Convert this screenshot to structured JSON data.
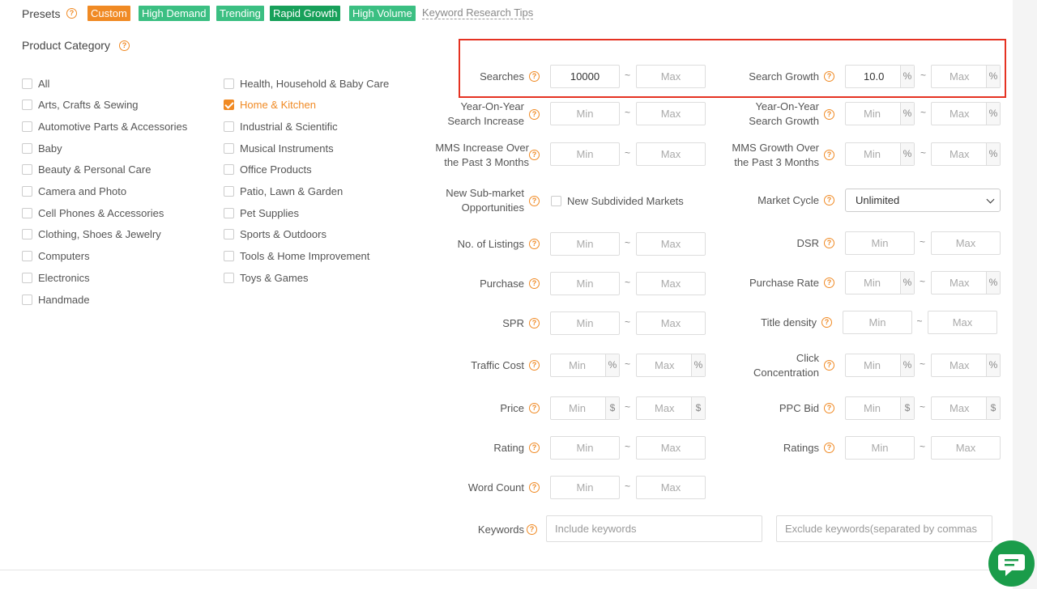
{
  "presets": {
    "label": "Presets",
    "tags": [
      {
        "label": "Custom",
        "color": "#f08a24"
      },
      {
        "label": "High Demand",
        "color": "#3bbf82"
      },
      {
        "label": "Trending",
        "color": "#3bbf82"
      },
      {
        "label": "Rapid Growth",
        "color": "#17a05a"
      },
      {
        "label": "High Volume",
        "color": "#3bbf82"
      }
    ],
    "tips": "Keyword Research Tips"
  },
  "categories": {
    "title": "Product Category",
    "col1": [
      "All",
      "Arts, Crafts & Sewing",
      "Automotive Parts & Accessories",
      "Baby",
      "Beauty & Personal Care",
      "Camera and Photo",
      "Cell Phones & Accessories",
      "Clothing, Shoes & Jewelry",
      "Computers",
      "Electronics",
      "Handmade"
    ],
    "col2": [
      "Health, Household & Baby Care",
      "Home & Kitchen",
      "Industrial & Scientific",
      "Musical Instruments",
      "Office Products",
      "Patio, Lawn & Garden",
      "Pet Supplies",
      "Sports & Outdoors",
      "Tools & Home Improvement",
      "Toys & Games"
    ],
    "selected": "Home & Kitchen"
  },
  "filters": {
    "searches": {
      "label": "Searches",
      "min": "10000",
      "max_ph": "Max"
    },
    "search_growth": {
      "label": "Search Growth",
      "min": "10.0",
      "max_ph": "Max"
    },
    "yoy_increase": {
      "label1": "Year-On-Year",
      "label2": "Search Increase",
      "min_ph": "Min",
      "max_ph": "Max"
    },
    "yoy_growth": {
      "label1": "Year-On-Year",
      "label2": "Search Growth",
      "min_ph": "Min",
      "max_ph": "Max"
    },
    "mms_increase": {
      "label1": "MMS Increase Over",
      "label2": "the Past 3 Months",
      "min_ph": "Min",
      "max_ph": "Max"
    },
    "mms_growth": {
      "label1": "MMS Growth Over",
      "label2": "the Past 3 Months",
      "min_ph": "Min",
      "max_ph": "Max"
    },
    "new_sub": {
      "label1": "New Sub-market",
      "label2": "Opportunities",
      "checkbox": "New Subdivided Markets"
    },
    "market_cycle": {
      "label": "Market Cycle",
      "value": "Unlimited"
    },
    "listings": {
      "label": "No. of Listings",
      "min_ph": "Min",
      "max_ph": "Max"
    },
    "dsr": {
      "label": "DSR",
      "min_ph": "Min",
      "max_ph": "Max"
    },
    "purchase": {
      "label": "Purchase",
      "min_ph": "Min",
      "max_ph": "Max"
    },
    "purchase_rate": {
      "label": "Purchase Rate",
      "min_ph": "Min",
      "max_ph": "Max"
    },
    "spr": {
      "label": "SPR",
      "min_ph": "Min",
      "max_ph": "Max"
    },
    "title_density": {
      "label": "Title density",
      "min_ph": "Min",
      "max_ph": "Max"
    },
    "traffic_cost": {
      "label": "Traffic Cost",
      "min_ph": "Min",
      "max_ph": "Max"
    },
    "click_conc": {
      "label1": "Click",
      "label2": "Concentration",
      "min_ph": "Min",
      "max_ph": "Max"
    },
    "price": {
      "label": "Price",
      "min_ph": "Min",
      "max_ph": "Max"
    },
    "ppc_bid": {
      "label": "PPC Bid",
      "min_ph": "Min",
      "max_ph": "Max"
    },
    "rating": {
      "label": "Rating",
      "min_ph": "Min",
      "max_ph": "Max"
    },
    "ratings": {
      "label": "Ratings",
      "min_ph": "Min",
      "max_ph": "Max"
    },
    "word_count": {
      "label": "Word Count",
      "min_ph": "Min",
      "max_ph": "Max"
    },
    "keywords": {
      "label": "Keywords",
      "include_ph": "Include keywords",
      "exclude_ph": "Exclude keywords(separated by commas"
    }
  },
  "symbols": {
    "percent": "%",
    "dollar": "$",
    "tilde": "~",
    "help": "?"
  },
  "colors": {
    "accent": "#f08a24",
    "highlight": "#e53222",
    "chat": "#1a9c4a"
  }
}
